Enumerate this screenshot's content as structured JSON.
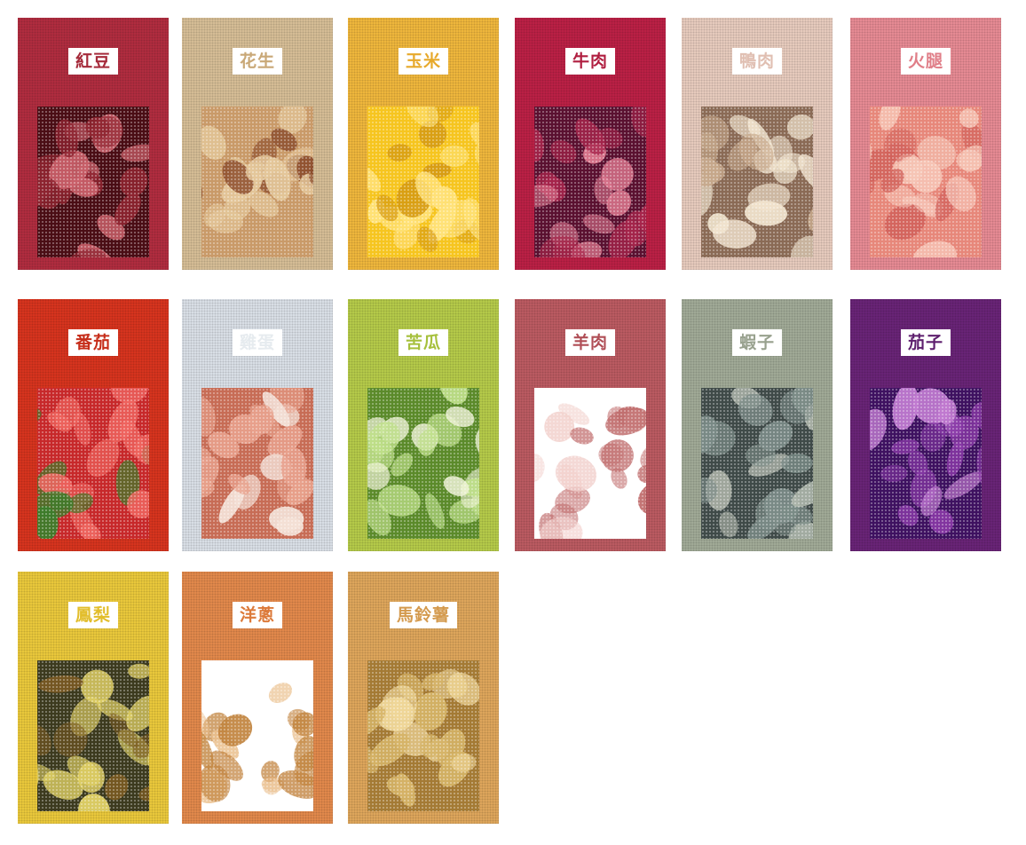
{
  "cards": [
    {
      "label": "紅豆",
      "bg": "#b22d40",
      "fg": "#a52a3a",
      "pic": [
        "#4a0d14",
        "#8e2430",
        "#c9606a"
      ]
    },
    {
      "label": "花生",
      "bg": "#d8bf97",
      "fg": "#c9a877",
      "pic": [
        "#c99a68",
        "#e4c79a",
        "#8a4a2a"
      ]
    },
    {
      "label": "玉米",
      "bg": "#f1b83d",
      "fg": "#e7a92b",
      "pic": [
        "#f6c51f",
        "#ffe27a",
        "#d59a12"
      ]
    },
    {
      "label": "牛肉",
      "bg": "#bd2146",
      "fg": "#b01e40",
      "pic": [
        "#5a1030",
        "#a8264c",
        "#e07a90"
      ]
    },
    {
      "label": "鴨肉",
      "bg": "#e9cdbf",
      "fg": "#e0bfb2",
      "pic": [
        "#8a6a55",
        "#f2e5cf",
        "#c7a98c"
      ]
    },
    {
      "label": "火腿",
      "bg": "#e88c95",
      "fg": "#e07e88",
      "pic": [
        "#e7877a",
        "#f6c5b6",
        "#d0605a"
      ]
    },
    {
      "label": "番茄",
      "bg": "#d9351f",
      "fg": "#c62d1a",
      "pic": [
        "#c7282a",
        "#ef6660",
        "#3b7d2a"
      ]
    },
    {
      "label": "雞蛋",
      "bg": "#dbe1e8",
      "fg": "#e6ebef",
      "pic": [
        "#c76c55",
        "#e8a18c",
        "#f3e0d6"
      ]
    },
    {
      "label": "苦瓜",
      "bg": "#b6cc4a",
      "fg": "#a6c03c",
      "pic": [
        "#5b8a2a",
        "#bfe08a",
        "#f1f4d9"
      ]
    },
    {
      "label": "羊肉",
      "bg": "#bd5b62",
      "fg": "#b04e56",
      "pic": [
        "#ffffff",
        "#c16e6e",
        "#f2d0cc"
      ]
    },
    {
      "label": "蝦子",
      "bg": "#a2ab98",
      "fg": "#98a18e",
      "pic": [
        "#3f4a48",
        "#7c8c88",
        "#b1b8ad"
      ]
    },
    {
      "label": "茄子",
      "bg": "#6a2478",
      "fg": "#5d1e6d",
      "pic": [
        "#3e1160",
        "#8a3aa8",
        "#c07ad0"
      ]
    },
    {
      "label": "鳳梨",
      "bg": "#ecca3c",
      "fg": "#e2bd2a",
      "pic": [
        "#3c3a1e",
        "#e2d266",
        "#7a5a22"
      ]
    },
    {
      "label": "洋蔥",
      "bg": "#e48a4c",
      "fg": "#dc7a3a",
      "pic": [
        "#ffffff",
        "#c2843f",
        "#eac08e"
      ]
    },
    {
      "label": "馬鈴薯",
      "bg": "#e0a75c",
      "fg": "#d49a4e",
      "pic": [
        "#a47a34",
        "#d5b366",
        "#f0d89a"
      ]
    }
  ]
}
